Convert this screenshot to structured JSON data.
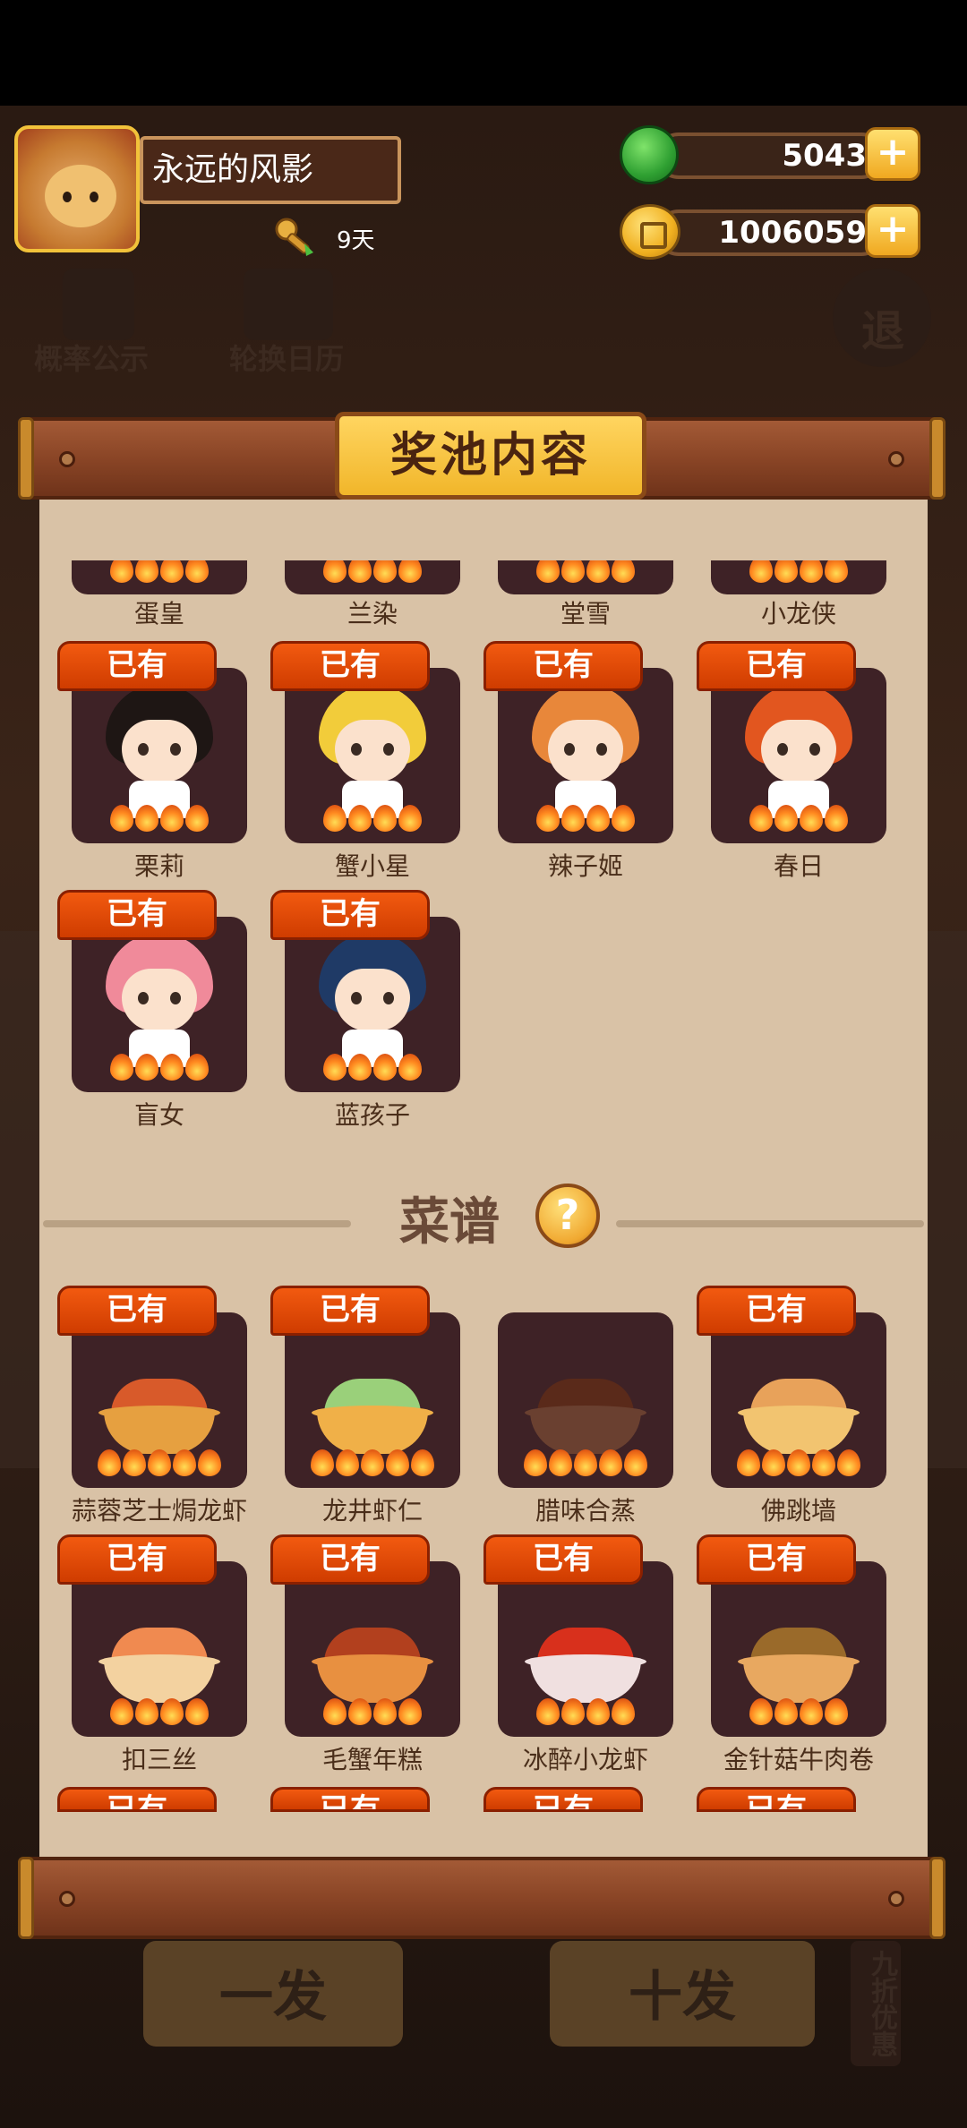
{
  "user": {
    "name": "永远的风影",
    "days": "9天"
  },
  "resources": {
    "gems": "5043",
    "coins": "1006059"
  },
  "background": {
    "probability": "概率公示",
    "calendar": "轮换日历",
    "exit": "退",
    "one_draw": "一发",
    "ten_draw": "十发",
    "discount": "九折优惠"
  },
  "panel": {
    "title": "奖池内容"
  },
  "owned_label": "已有",
  "chefs_top_row": [
    "蛋皇",
    "兰染",
    "堂雪",
    "小龙侠"
  ],
  "chefs": [
    {
      "name": "栗莉",
      "owned": true,
      "hair": "#1e1614",
      "stars": 4
    },
    {
      "name": "蟹小星",
      "owned": true,
      "hair": "#f2cc3a",
      "stars": 4
    },
    {
      "name": "辣子姬",
      "owned": true,
      "hair": "#e8873a",
      "stars": 4
    },
    {
      "name": "春日",
      "owned": true,
      "hair": "#e2561f",
      "stars": 4
    },
    {
      "name": "盲女",
      "owned": true,
      "hair": "#f08a9a",
      "stars": 4
    },
    {
      "name": "蓝孩子",
      "owned": true,
      "hair": "#1f3a66",
      "stars": 4
    }
  ],
  "recipes_section": {
    "title": "菜谱",
    "help": "?"
  },
  "recipes": [
    {
      "name": "蒜蓉芝士焗龙虾",
      "owned": true,
      "stars": 5,
      "food": "#d85a2a",
      "bowl": "#e6a040"
    },
    {
      "name": "龙井虾仁",
      "owned": true,
      "stars": 5,
      "food": "#9ad07a",
      "bowl": "#f0b048"
    },
    {
      "name": "腊味合蒸",
      "owned": false,
      "stars": 5,
      "food": "#5a2a1a",
      "bowl": "#6a4030"
    },
    {
      "name": "佛跳墙",
      "owned": true,
      "stars": 5,
      "food": "#e8a25a",
      "bowl": "#f2c470"
    },
    {
      "name": "扣三丝",
      "owned": true,
      "stars": 4,
      "food": "#f08a50",
      "bowl": "#f3d2a0"
    },
    {
      "name": "毛蟹年糕",
      "owned": true,
      "stars": 4,
      "food": "#b2401e",
      "bowl": "#e89040"
    },
    {
      "name": "冰醉小龙虾",
      "owned": true,
      "stars": 4,
      "food": "#d8301c",
      "bowl": "#f0e0e0"
    },
    {
      "name": "金针菇牛肉卷",
      "owned": true,
      "stars": 4,
      "food": "#9a6a2a",
      "bowl": "#e8a860"
    }
  ],
  "recipes_cut_row_owned": [
    true,
    true,
    true,
    true
  ]
}
